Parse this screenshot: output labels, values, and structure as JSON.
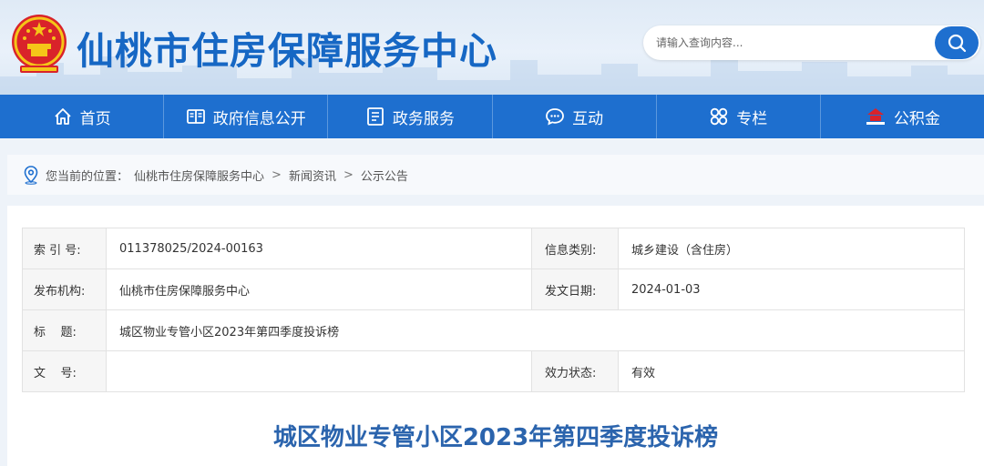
{
  "header": {
    "site_title": "仙桃市住房保障服务中心",
    "search_placeholder": "请输入查询内容...",
    "emblem_icon": "national-emblem-icon",
    "search_icon": "search-icon"
  },
  "nav": {
    "items": [
      {
        "label": "首页",
        "icon": "home-icon"
      },
      {
        "label": "政府信息公开",
        "icon": "document-open-icon"
      },
      {
        "label": "政务服务",
        "icon": "service-list-icon"
      },
      {
        "label": "互动",
        "icon": "chat-bubble-icon"
      },
      {
        "label": "专栏",
        "icon": "grid-icon"
      },
      {
        "label": "公积金",
        "icon": "housing-fund-logo-icon"
      }
    ]
  },
  "breadcrumb": {
    "prefix": "您当前的位置：",
    "items": [
      "仙桃市住房保障服务中心",
      "新闻资讯",
      "公示公告"
    ],
    "separator": ">",
    "icon": "location-pin-icon"
  },
  "info": {
    "rows": [
      {
        "label1": "索 引 号:",
        "value1": "011378025/2024-00163",
        "label2": "信息类别:",
        "value2": "城乡建设（含住房）"
      },
      {
        "label1": "发布机构:",
        "value1": "仙桃市住房保障服务中心",
        "label2": "发文日期:",
        "value2": "2024-01-03"
      },
      {
        "label1": "标    题:",
        "value1": "城区物业专管小区2023年第四季度投诉榜"
      },
      {
        "label1": "文    号:",
        "value1": "",
        "label2": "效力状态:",
        "value2": "有效"
      }
    ]
  },
  "article": {
    "title": "城区物业专管小区2023年第四季度投诉榜"
  },
  "colors": {
    "brand_blue": "#1e6fcf",
    "title_blue": "#1667c4",
    "article_title": "#2b64ad"
  }
}
